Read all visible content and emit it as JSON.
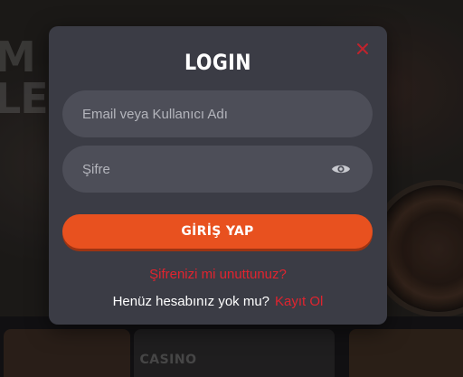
{
  "background": {
    "hero_text_lines": [
      "M",
      "LER"
    ],
    "category_label": "CASINO"
  },
  "modal": {
    "title": "LOGIN",
    "close_icon": "close-icon",
    "email_placeholder": "Email veya Kullanıcı Adı",
    "email_value": "",
    "password_placeholder": "Şifre",
    "password_value": "",
    "show_password_icon": "eye-icon",
    "login_button_label": "GİRİŞ YAP",
    "forgot_password_label": "Şifrenizi mi unuttunuz?",
    "no_account_text": "Henüz hesabınız yok mu?",
    "signup_label": "Kayıt Ol"
  },
  "colors": {
    "modal_bg": "#3b3c45",
    "field_bg": "#4d4e58",
    "accent_orange": "#e8511f",
    "link_red": "#e0242f"
  }
}
